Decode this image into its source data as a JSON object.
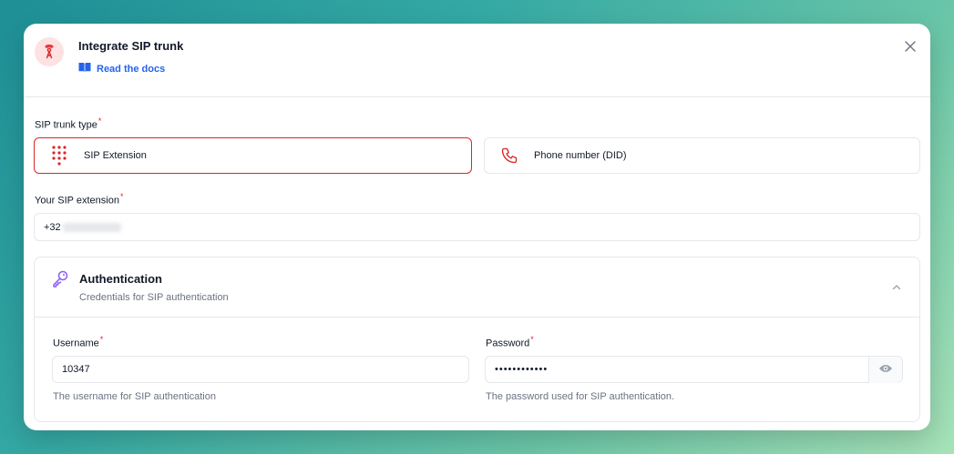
{
  "modal": {
    "title": "Integrate SIP trunk",
    "docs_link": "Read the docs"
  },
  "trunk_type": {
    "label": "SIP trunk type",
    "options": [
      {
        "label": "SIP Extension",
        "selected": true,
        "icon": "dialpad-icon"
      },
      {
        "label": "Phone number (DID)",
        "selected": false,
        "icon": "phone-icon"
      }
    ]
  },
  "extension": {
    "label": "Your SIP extension",
    "value_prefix": "+32"
  },
  "auth": {
    "title": "Authentication",
    "subtitle": "Credentials for SIP authentication",
    "expanded": true,
    "username": {
      "label": "Username",
      "value": "10347",
      "helper": "The username for SIP authentication"
    },
    "password": {
      "label": "Password",
      "value": "••••••••••••",
      "helper": "The password used for SIP authentication."
    }
  },
  "colors": {
    "accent": "#dc2626",
    "link": "#2563eb",
    "key_icon": "#8b5cf6"
  }
}
